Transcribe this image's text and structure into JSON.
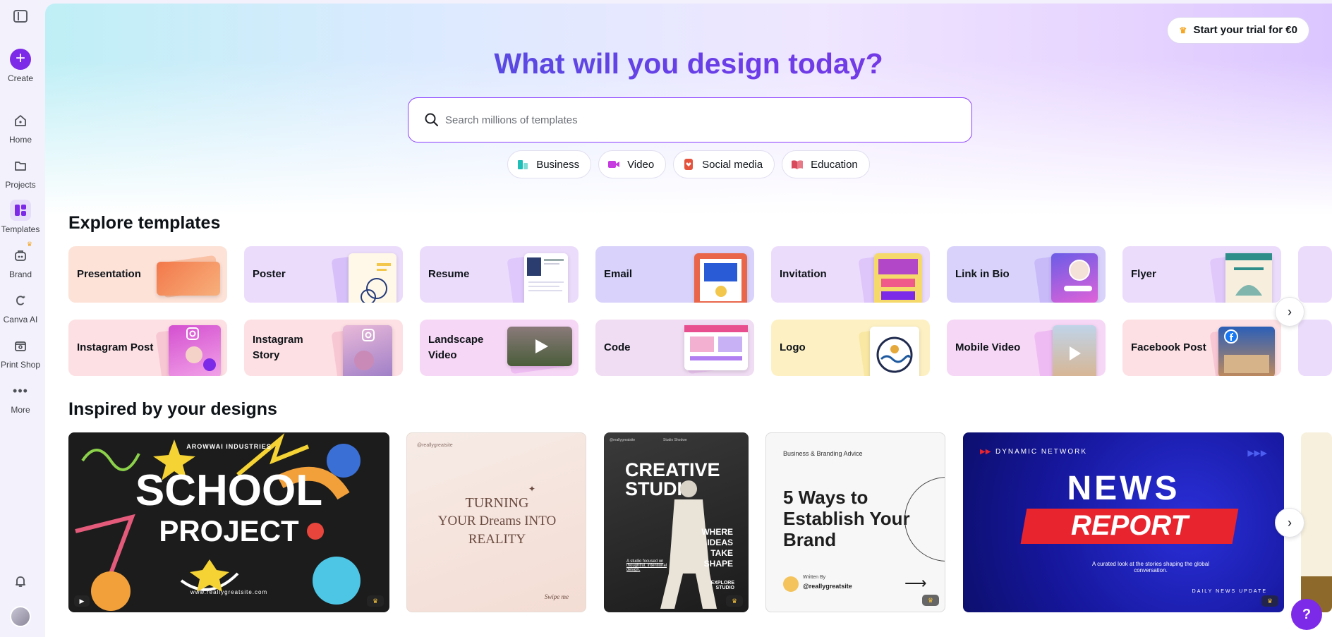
{
  "sidebar": {
    "create_label": "Create",
    "items": [
      {
        "label": "Home",
        "icon": "home-icon"
      },
      {
        "label": "Projects",
        "icon": "folder-icon"
      },
      {
        "label": "Templates",
        "icon": "templates-icon"
      },
      {
        "label": "Brand",
        "icon": "brand-icon"
      },
      {
        "label": "Canva AI",
        "icon": "canva-ai-icon"
      },
      {
        "label": "Print Shop",
        "icon": "print-shop-icon"
      },
      {
        "label": "More",
        "icon": "more-icon"
      }
    ]
  },
  "header": {
    "trial_label": "Start your trial for €0",
    "title": "What will you design today?",
    "search_placeholder": "Search millions of templates"
  },
  "chips": [
    {
      "label": "Business",
      "color": "#1fbfb8"
    },
    {
      "label": "Video",
      "color": "#c63be0"
    },
    {
      "label": "Social media",
      "color": "#e5533d"
    },
    {
      "label": "Education",
      "color": "#d94a5d"
    }
  ],
  "explore": {
    "title": "Explore templates",
    "row1": [
      "Presentation",
      "Poster",
      "Resume",
      "Email",
      "Invitation",
      "Link in Bio",
      "Flyer"
    ],
    "row2": [
      "Instagram Post",
      "Instagram Story",
      "Landscape Video",
      "Code",
      "Logo",
      "Mobile Video",
      "Facebook Post"
    ]
  },
  "inspired": {
    "title": "Inspired by your designs",
    "cards": {
      "school_brand": "AROWWAI INDUSTRIES",
      "school_title1": "SCHOOL",
      "school_title2": "PROJECT",
      "school_url": "www.reallygreatsite.com",
      "dreams_handle": "@reallygreatsite",
      "dreams_line1": "TURNING",
      "dreams_line2": "YOUR Dreams INTO",
      "dreams_line3": "REALITY",
      "dreams_swipe": "Swipe me",
      "studio_handle1": "@reallygreatsite",
      "studio_label": "Studio Shodwe",
      "studio_title": "CREATIVE STUDIO",
      "studio_sub": "WHERE IDEAS TAKE SHAPE",
      "studio_caption": "A studio focused on thoughtful, intentional design.",
      "studio_explore": "EXPLORE STUDIO",
      "brand_kicker": "Business & Branding Advice",
      "brand_title": "5 Ways to Establish Your Brand",
      "brand_written": "Written By",
      "brand_handle": "@reallygreatsite",
      "news_network": "DYNAMIC NETWORK",
      "news_title1": "NEWS",
      "news_title2": "REPORT",
      "news_caption": "A curated look at the stories shaping the global conversation.",
      "news_footer": "DAILY NEWS UPDATE"
    }
  },
  "help_label": "?"
}
